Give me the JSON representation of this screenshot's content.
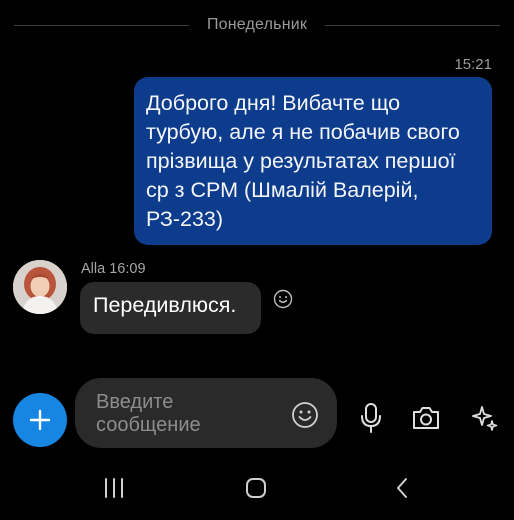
{
  "day_separator": "Понедельник",
  "messages": {
    "outgoing": {
      "time": "15:21",
      "lines": [
        "Доброго дня! Вибачте що",
        "турбую, але я не побачив свого",
        "прізвища у результатах першої",
        "ср з СРМ (Шмалій Валерій,",
        "РЗ-233)"
      ]
    },
    "incoming": {
      "sender": "Alla",
      "time": "16:09",
      "text": "Передивлюся."
    }
  },
  "composer": {
    "placeholder": "Введите сообщение"
  },
  "colors": {
    "background": "#000000",
    "outgoing_bubble": "#0e3c8c",
    "incoming_bubble": "#2b2b2b",
    "accent": "#1686e2",
    "input_bg": "#2a2a2a",
    "secondary_text": "#9a9a9a"
  },
  "icons": {
    "react": "emoji-icon",
    "plus": "plus-icon",
    "input_emoji": "emoji-icon",
    "mic": "microphone-icon",
    "camera": "camera-icon",
    "ai": "sparkles-icon",
    "nav_recent": "recent-apps-icon",
    "nav_home": "home-icon",
    "nav_back": "back-icon"
  }
}
